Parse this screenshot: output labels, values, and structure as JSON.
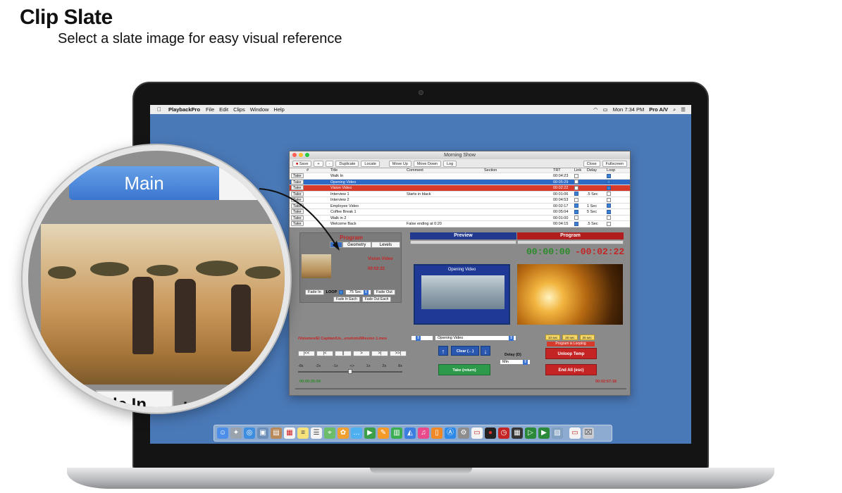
{
  "header": {
    "title": "Clip Slate",
    "subtitle": "Select a slate image for easy visual reference"
  },
  "menubar": {
    "app": "PlaybackPro",
    "menus": [
      "File",
      "Edit",
      "Clips",
      "Window",
      "Help"
    ],
    "clock": "Mon 7:34 PM",
    "user": "Pro A/V"
  },
  "window": {
    "title": "Morning Show",
    "toolbar": {
      "save": "Save",
      "add": "+",
      "remove": "-",
      "duplicate": "Duplicate",
      "locate": "Locate",
      "move_up": "Move Up",
      "move_down": "Move Down",
      "log": "Log",
      "close": "Close",
      "fullscreen": "Fullscreen"
    },
    "columns": {
      "num": "#",
      "title": "Title",
      "comment": "Comment",
      "section": "Section",
      "trt": "TRT",
      "link": "Link",
      "delay": "Delay",
      "loop": "Loop"
    },
    "take_label": "Take",
    "rows": [
      {
        "title": "Walk In",
        "comment": "",
        "trt": "00:04:23",
        "link": false,
        "delay": "",
        "loop": true,
        "state": ""
      },
      {
        "title": "Opening Video",
        "comment": "",
        "trt": "00:05:29",
        "link": false,
        "delay": "",
        "loop": true,
        "state": "sel"
      },
      {
        "title": "Vision Video",
        "comment": "",
        "trt": "00:02:22",
        "link": false,
        "delay": "",
        "loop": true,
        "state": "red"
      },
      {
        "title": "Interview 1",
        "comment": "Starts in black",
        "trt": "00:01:06",
        "link": true,
        "delay": ".5 Sec",
        "loop": false,
        "state": ""
      },
      {
        "title": "Interview 2",
        "comment": "",
        "trt": "00:04:53",
        "link": false,
        "delay": "",
        "loop": false,
        "state": ""
      },
      {
        "title": "Employee Video",
        "comment": "",
        "trt": "00:02:17",
        "link": true,
        "delay": "1 Sec",
        "loop": true,
        "state": ""
      },
      {
        "title": "Coffee Break 1",
        "comment": "",
        "trt": "00:05:04",
        "link": true,
        "delay": "5 Sec",
        "loop": true,
        "state": ""
      },
      {
        "title": "Walk in 2",
        "comment": "",
        "trt": "00:01:00",
        "link": false,
        "delay": "",
        "loop": false,
        "state": ""
      },
      {
        "title": "Welcome Back",
        "comment": "False ending at 0:20",
        "trt": "00:04:15",
        "link": true,
        "delay": ".5 Sec",
        "loop": false,
        "state": ""
      }
    ],
    "program_panel": {
      "label": "Program",
      "tab_geometry": "Geometry",
      "tab_levels": "Levels",
      "clip_name": "Vision Video",
      "clip_time": "00:02:22",
      "fade_in": "Fade In",
      "loop_label": "LOOP",
      "fade_time": ".75 Sec",
      "fade_out": "Fade Out",
      "fade_in_each": "Fade In Each",
      "fade_out_each": "Fade Out Each"
    },
    "preview": {
      "header": "Preview",
      "clip_title": "Opening Video"
    },
    "program": {
      "header": "Program",
      "elapsed": "00:00:00",
      "remaining": "-00:02:22"
    },
    "path": "/Volumes/El Capitan/Us...enshots/Mission 1.mov",
    "transport": [
      "|<<",
      "|<",
      "||",
      ">",
      ">|",
      ">>|"
    ],
    "speeds": [
      "-8x",
      "-2x",
      "-1x",
      "<>",
      "1x",
      "2x",
      "8x"
    ],
    "time_elapsed": "00:00:35:04",
    "time_remaining": "00:02:57:18",
    "next_clip": "Opening Video",
    "clear_label": "Clear (←)",
    "take_button": "Take (return)",
    "delay_label": "Delay (D)",
    "delay_unit": "Min",
    "quick_times": [
      "10 sec",
      "20 sec",
      "30 sec"
    ],
    "looping_status": "Program is Looping",
    "unloop_button": "Unloop Temp",
    "end_all_button": "End All (esc)"
  },
  "magnifier": {
    "tab_label": "Main",
    "bottom_label": "de In",
    "bottom_label_right": "LO"
  },
  "colors": {
    "desktop": "#4a79b8",
    "preview_blue": "#213a8f",
    "program_red": "#b11c1c",
    "selected_row": "#2d6ac6",
    "onair_row": "#d63a2c"
  }
}
